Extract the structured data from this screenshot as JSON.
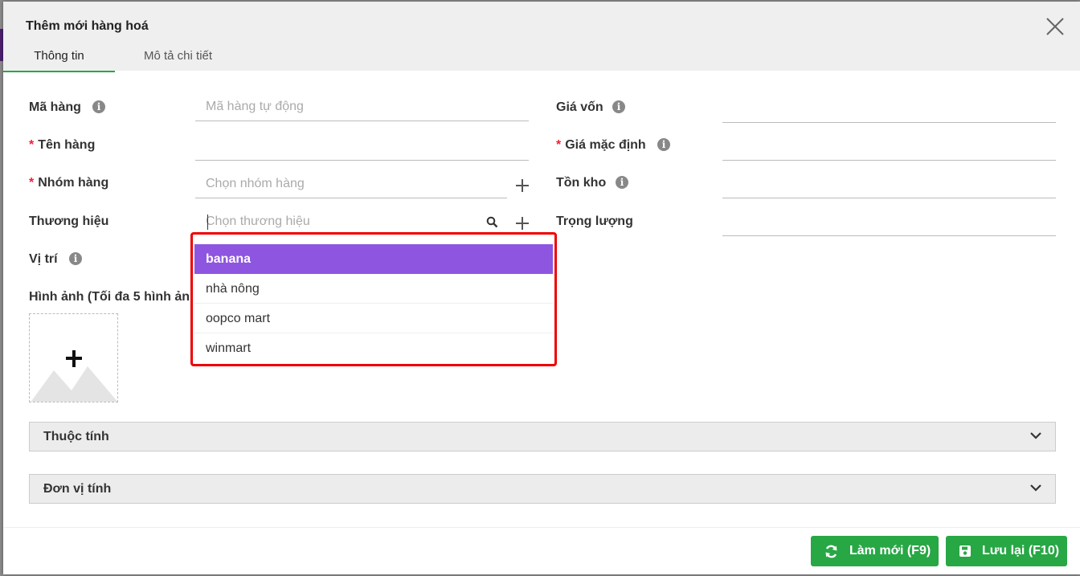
{
  "dialog": {
    "title": "Thêm mới hàng hoá",
    "tabs": [
      "Thông tin",
      "Mô tả chi tiết"
    ]
  },
  "form": {
    "code_label": "Mã hàng",
    "code_placeholder": "Mã hàng tự động",
    "name_label": "Tên hàng",
    "group_label": "Nhóm hàng",
    "group_placeholder": "Chọn nhóm hàng",
    "brand_label": "Thương hiệu",
    "brand_placeholder": "Chọn thương hiệu",
    "location_label": "Vị trí",
    "images_label": "Hình ảnh (Tối đa 5 hình ảnh)",
    "cost_label": "Giá vốn",
    "price_label": "Giá mặc định",
    "stock_label": "Tồn kho",
    "weight_label": "Trọng lượng",
    "required_mark": "*"
  },
  "brand_dropdown": {
    "options": [
      "banana",
      "nhà nông",
      "oopco mart",
      "winmart"
    ],
    "highlighted": "banana"
  },
  "sections": {
    "attributes": "Thuộc tính",
    "units": "Đơn vị tính"
  },
  "buttons": {
    "refresh": "Làm mới (F9)",
    "save": "Lưu lại (F10)"
  },
  "colors": {
    "primary_green": "#28a745",
    "highlight_purple": "#8e55e0",
    "dropdown_border_red": "#e00000"
  }
}
